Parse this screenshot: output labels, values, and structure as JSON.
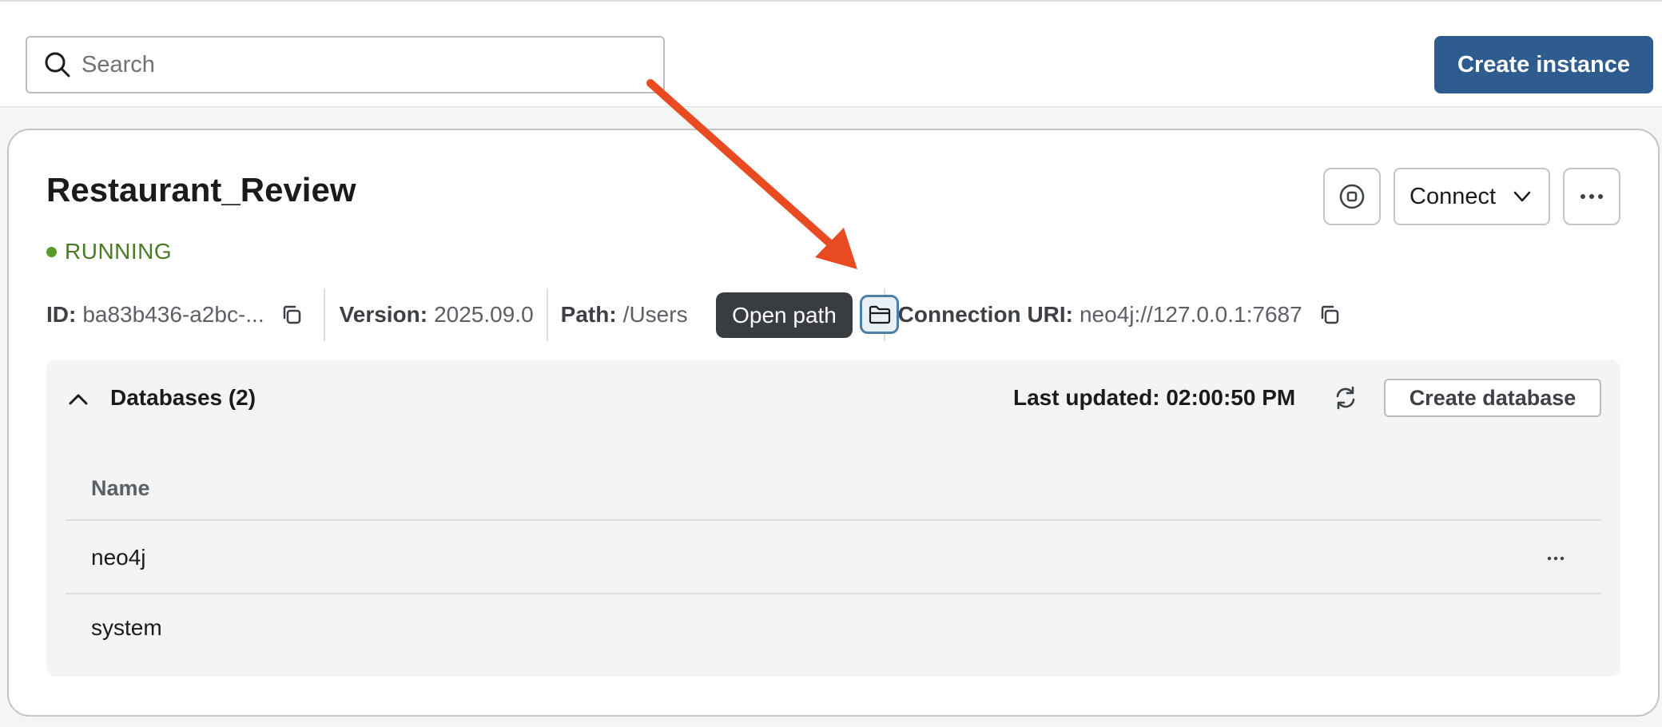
{
  "search": {
    "placeholder": "Search",
    "icon": "search-icon"
  },
  "header": {
    "create_instance_label": "Create instance"
  },
  "instance": {
    "name": "Restaurant_Review",
    "status": "RUNNING",
    "status_color": "#5a9a2b",
    "actions": {
      "connect_label": "Connect"
    },
    "info": {
      "id_label": "ID:",
      "id_value": "ba83b436-a2bc-...",
      "version_label": "Version:",
      "version_value": "2025.09.0",
      "path_label": "Path:",
      "path_value": "/Users",
      "uri_label": "Connection URI:",
      "uri_value": "neo4j://127.0.0.1:7687"
    },
    "tooltip": "Open path"
  },
  "databases": {
    "title": "Databases (2)",
    "last_updated": "Last updated: 02:00:50 PM",
    "create_label": "Create database",
    "column_name": "Name",
    "rows": [
      {
        "name": "neo4j"
      },
      {
        "name": "system"
      }
    ]
  },
  "colors": {
    "primary": "#2e5c8f",
    "annotation_arrow": "#e84a22"
  }
}
